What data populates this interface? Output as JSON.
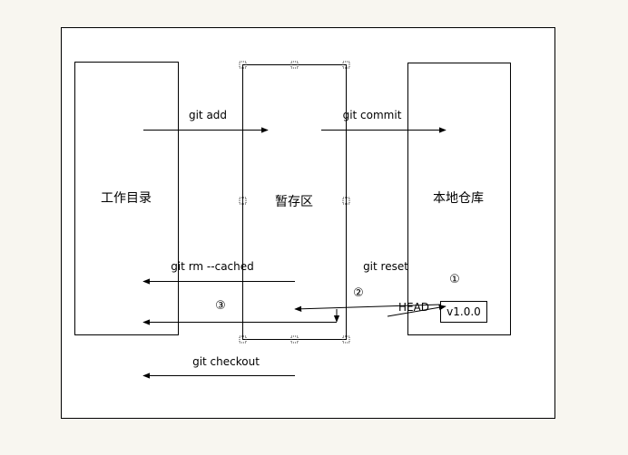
{
  "diagram": {
    "working_dir": "工作目录",
    "staging": "暂存区",
    "local_repo": "本地仓库",
    "git_add": "git add",
    "git_commit": "git commit",
    "git_rm_cached": "git rm --cached",
    "git_reset": "git reset",
    "git_checkout": "git checkout",
    "head": "HEAD",
    "version": "v1.0.0",
    "marker_1": "①",
    "marker_2": "②",
    "marker_3": "③"
  }
}
